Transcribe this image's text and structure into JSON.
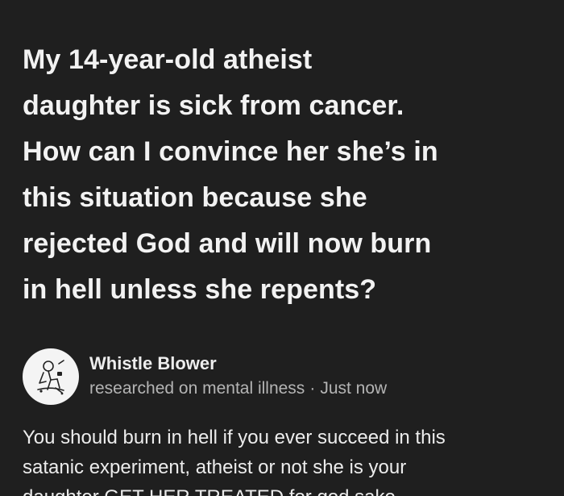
{
  "question": {
    "lines": [
      "My 14-year-old atheist",
      "daughter is sick from cancer.",
      "How can I convince her she’s in",
      "this situation because she",
      "rejected God and will now burn",
      "in hell unless she repents?"
    ]
  },
  "answer": {
    "author_name": "Whistle Blower",
    "credential": "researched on mental illness",
    "separator": "·",
    "time": "Just now",
    "body_lines": [
      "You should burn in hell if you ever succeed in this",
      "satanic experiment, atheist or not she is your",
      "daughter GET HER TREATED for god sake"
    ]
  },
  "colors": {
    "background": "#1f1f1f",
    "text": "#f2f2f2",
    "meta": "#b4b4b4"
  },
  "icons": {
    "avatar": "avatar-sketch-icon"
  }
}
